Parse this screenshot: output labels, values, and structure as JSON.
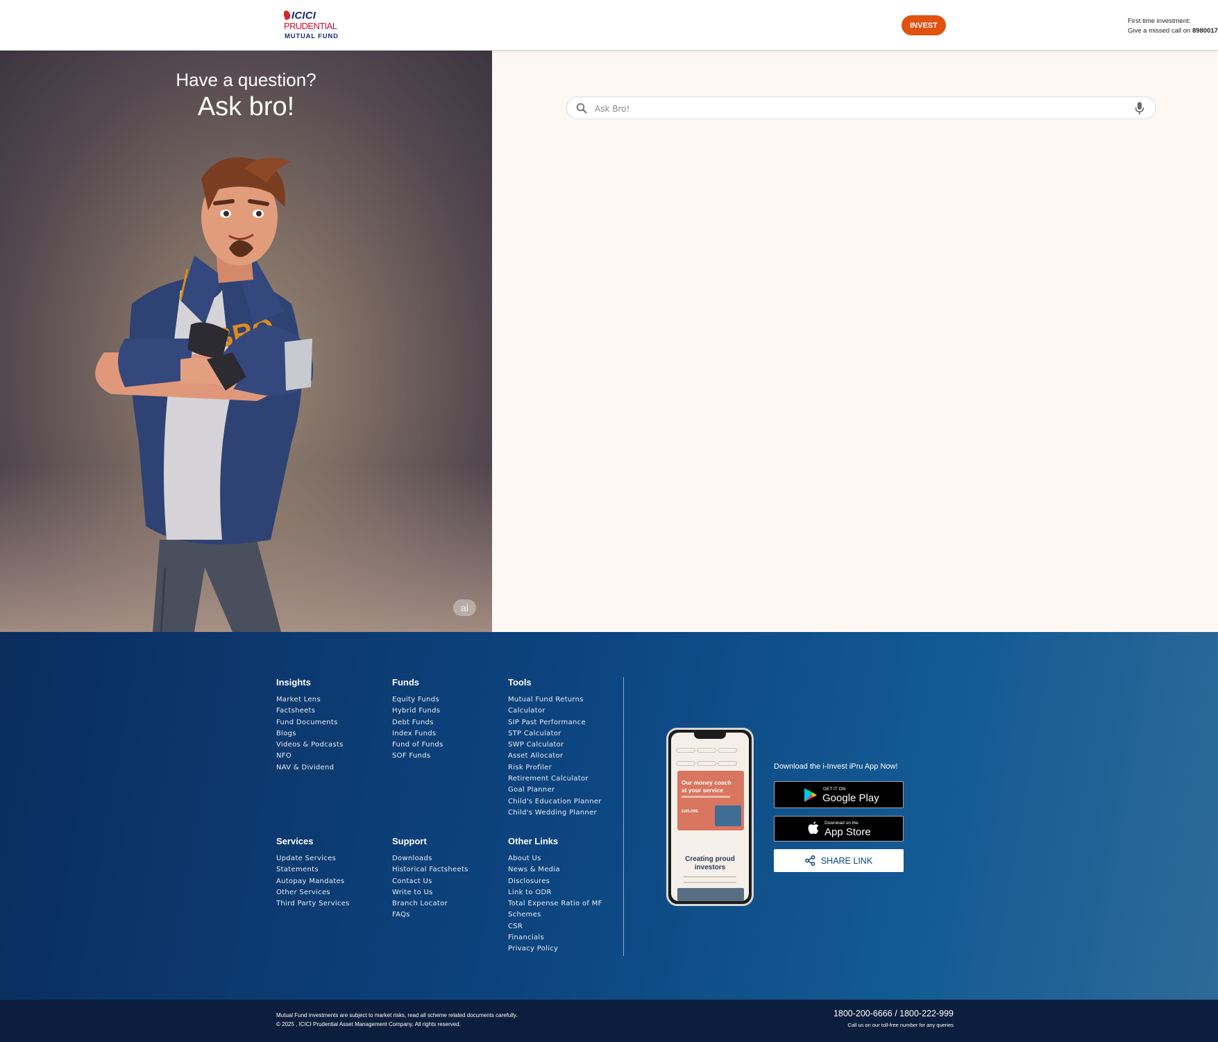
{
  "header": {
    "logo": {
      "line1": "ICICI",
      "line2": "PRUDENTIAL",
      "line3": "MUTUAL FUND"
    },
    "invest_label": "INVEST",
    "missed_call_line1": "First time investment:",
    "missed_call_prefix": "Give a missed call on ",
    "missed_call_number": "8980017"
  },
  "hero": {
    "question": "Have a question?",
    "title": "Ask bro!",
    "ai_badge": "ai",
    "shirt_text": "BRO"
  },
  "search": {
    "placeholder": "Ask Bro!"
  },
  "footer": {
    "columns": [
      {
        "title": "Insights",
        "links": [
          "Market Lens",
          "Factsheets",
          "Fund Documents",
          "Blogs",
          "Videos & Podcasts",
          "NFO",
          "NAV & Dividend"
        ]
      },
      {
        "title": "Funds",
        "links": [
          "Equity Funds",
          "Hybrid Funds",
          "Debt Funds",
          "Index Funds",
          "Fund of Funds",
          "SOF Funds"
        ]
      },
      {
        "title": "Tools",
        "links": [
          "Mutual Fund Returns",
          "Calculator",
          "SIP Past Performance",
          "STP Calculator",
          "SWP Calculator",
          "Asset Allocator",
          "Risk Profiler",
          "Retirement Calculator",
          "Goal Planner",
          "Child's Education Planner",
          "Child's Wedding Planner"
        ]
      },
      {
        "title": "Services",
        "links": [
          "Update Services",
          "Statements",
          "Autopay Mandates",
          "Other Services",
          "Third Party Services"
        ]
      },
      {
        "title": "Support",
        "links": [
          "Downloads",
          "Historical Factsheets",
          "Contact Us",
          "Write to Us",
          "Branch Locator",
          "FAQs"
        ]
      },
      {
        "title": "Other Links",
        "links": [
          "About Us",
          "News & Media",
          "Disclosures",
          "Link to ODR",
          "Total Expense Ratio of MF",
          "Schemes",
          "CSR",
          "Financials",
          "Privacy Policy"
        ]
      }
    ],
    "phone_mock": {
      "card_title": "Our money coach at your service",
      "card_cta": "EXPLORE",
      "headline": "Creating proud investors"
    },
    "download_title": "Download the i-Invest iPru App Now!",
    "google_play": {
      "small": "GET IT ON",
      "big": "Google Play"
    },
    "app_store": {
      "small": "Download on the",
      "big": "App Store"
    },
    "share_label": "SHARE LINK"
  },
  "bottom_bar": {
    "disclaimer_line1": "Mutual Fund investments are subject to market risks, read all scheme related documents carefully.",
    "disclaimer_line2": "© 2025 , ICICI Prudential Asset Management Company. All rights reserved.",
    "phone_numbers": "1800-200-6666 / 1800-222-999",
    "toll_free_note": "Call us on our toll-free number for any queries"
  },
  "colors": {
    "invest": "#e0520f",
    "footer_dark": "#0b2d5e",
    "footer_light": "#2e6a98",
    "bottom_bar": "#0c1e3d",
    "search_bg": "#fdf8f4"
  },
  "icons": [
    "search-icon",
    "mic-icon",
    "google-play-icon",
    "apple-icon",
    "share-icon"
  ]
}
